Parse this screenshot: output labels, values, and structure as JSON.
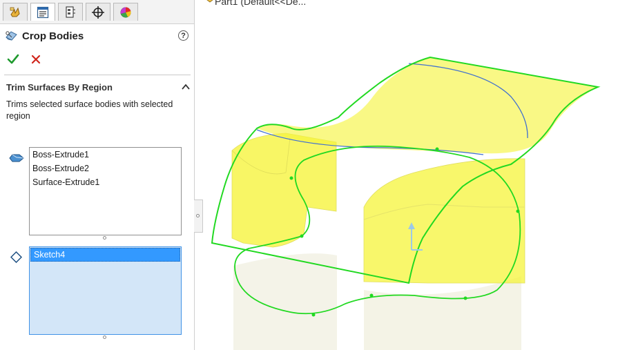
{
  "tabs": [
    {
      "name": "FeatureManager design tree",
      "icon": "feature-manager-icon"
    },
    {
      "name": "PropertyManager",
      "icon": "property-manager-icon",
      "active": true
    },
    {
      "name": "ConfigurationManager",
      "icon": "configuration-manager-icon"
    },
    {
      "name": "DimXpertManager",
      "icon": "dimxpert-manager-icon"
    },
    {
      "name": "DisplayManager",
      "icon": "display-manager-icon"
    }
  ],
  "feature": {
    "title": "Crop Bodies",
    "help_label": "?",
    "ok_icon": "checkmark-icon",
    "cancel_icon": "x-icon"
  },
  "section": {
    "title": "Trim Surfaces By Region",
    "description": "Trims selected surface bodies with selected region",
    "bodies": [
      "Boss-Extrude1",
      "Boss-Extrude2",
      "Surface-Extrude1"
    ],
    "regions": [
      "Sketch4"
    ]
  },
  "graphics": {
    "tree_item": "Part1 (Default<<De..."
  },
  "colors": {
    "sketch_green": "#21d921",
    "surface_yellow": "#f6f43a",
    "selection_blue": "#3399ff",
    "list_selected_bg": "#d3e6f8"
  }
}
